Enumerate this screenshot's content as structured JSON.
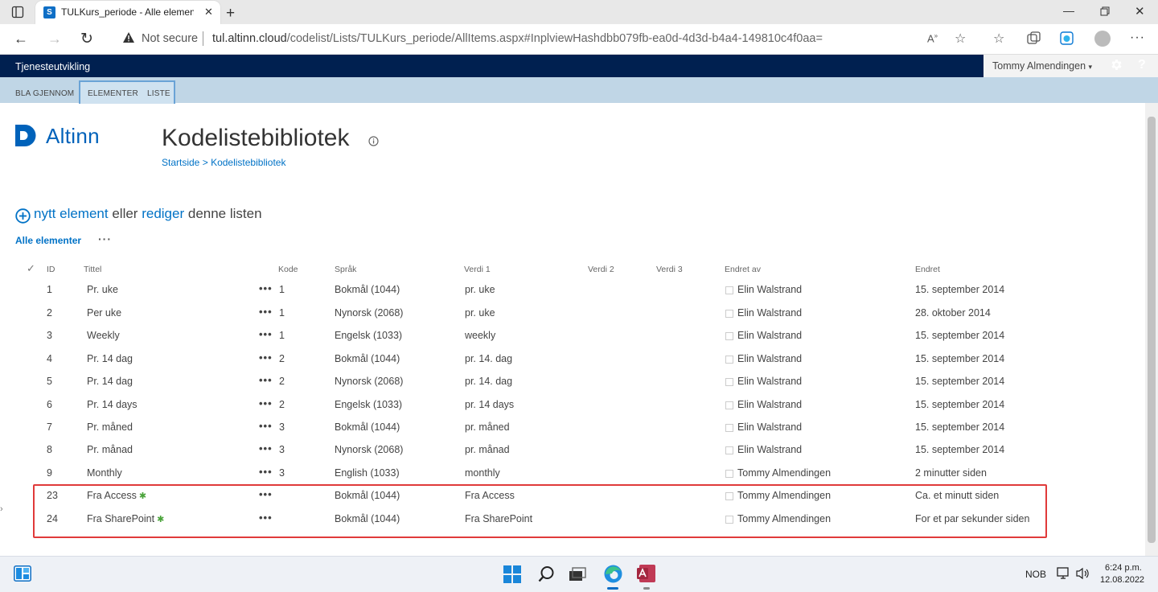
{
  "browser": {
    "tab_title": "TULKurs_periode - Alle elemente",
    "tab_favicon_letter": "S",
    "security_label": "Not secure",
    "url_domain": "tul.altinn.cloud",
    "url_path": "/codelist/Lists/TULKurs_periode/AllItems.aspx#InplviewHashdbb079fb-ea0d-4d3d-b4a4-149810c4f0aa="
  },
  "suitebar": {
    "brand": "Tjenesteutvikling",
    "user": "Tommy Almendingen",
    "settings_icon": "gear-icon",
    "help_label": "?"
  },
  "ribbon": {
    "tabs": [
      "BLA GJENNOM",
      "ELEMENTER",
      "LISTE"
    ]
  },
  "site": {
    "logo_text": "Altinn",
    "title": "Kodelistebibliotek",
    "breadcrumb": [
      "Startside",
      ">",
      "Kodelistebibliotek"
    ]
  },
  "list": {
    "new_item_link": "nytt element",
    "new_item_middle": "eller",
    "edit_link": "rediger",
    "new_item_tail": "denne listen",
    "view_name": "Alle elementer",
    "view_more": "···",
    "columns": {
      "id": "ID",
      "title": "Tittel",
      "kode": "Kode",
      "sprak": "Språk",
      "verdi1": "Verdi 1",
      "verdi2": "Verdi 2",
      "verdi3": "Verdi 3",
      "endret_av": "Endret av",
      "endret": "Endret"
    },
    "rows": [
      {
        "id": "1",
        "title": "Pr. uke",
        "kode": "1",
        "sprak": "Bokmål (1044)",
        "verdi1": "pr. uke",
        "endret_av": "Elin Walstrand",
        "endret": "15. september 2014",
        "new": false
      },
      {
        "id": "2",
        "title": "Per uke",
        "kode": "1",
        "sprak": "Nynorsk (2068)",
        "verdi1": "pr. uke",
        "endret_av": "Elin Walstrand",
        "endret": "28. oktober 2014",
        "new": false
      },
      {
        "id": "3",
        "title": "Weekly",
        "kode": "1",
        "sprak": "Engelsk (1033)",
        "verdi1": "weekly",
        "endret_av": "Elin Walstrand",
        "endret": "15. september 2014",
        "new": false
      },
      {
        "id": "4",
        "title": "Pr. 14 dag",
        "kode": "2",
        "sprak": "Bokmål (1044)",
        "verdi1": "pr. 14. dag",
        "endret_av": "Elin Walstrand",
        "endret": "15. september 2014",
        "new": false
      },
      {
        "id": "5",
        "title": "Pr. 14 dag",
        "kode": "2",
        "sprak": "Nynorsk (2068)",
        "verdi1": "pr. 14. dag",
        "endret_av": "Elin Walstrand",
        "endret": "15. september 2014",
        "new": false
      },
      {
        "id": "6",
        "title": "Pr. 14 days",
        "kode": "2",
        "sprak": "Engelsk (1033)",
        "verdi1": "pr. 14 days",
        "endret_av": "Elin Walstrand",
        "endret": "15. september 2014",
        "new": false
      },
      {
        "id": "7",
        "title": "Pr. måned",
        "kode": "3",
        "sprak": "Bokmål (1044)",
        "verdi1": "pr. måned",
        "endret_av": "Elin Walstrand",
        "endret": "15. september 2014",
        "new": false
      },
      {
        "id": "8",
        "title": "Pr. månad",
        "kode": "3",
        "sprak": "Nynorsk (2068)",
        "verdi1": "pr. månad",
        "endret_av": "Elin Walstrand",
        "endret": "15. september 2014",
        "new": false
      },
      {
        "id": "9",
        "title": "Monthly",
        "kode": "3",
        "sprak": "English (1033)",
        "verdi1": "monthly",
        "endret_av": "Tommy Almendingen",
        "endret": "2 minutter siden",
        "new": false
      },
      {
        "id": "23",
        "title": "Fra Access",
        "kode": "",
        "sprak": "Bokmål (1044)",
        "verdi1": "Fra Access",
        "endret_av": "Tommy Almendingen",
        "endret": "Ca. et minutt siden",
        "new": true
      },
      {
        "id": "24",
        "title": "Fra SharePoint",
        "kode": "",
        "sprak": "Bokmål (1044)",
        "verdi1": "Fra SharePoint",
        "endret_av": "Tommy Almendingen",
        "endret": "For et par sekunder siden",
        "new": true
      }
    ],
    "row_menu": "•••",
    "new_badge": "✱"
  },
  "taskbar": {
    "language": "NOB",
    "time": "6:24 p.m.",
    "date": "12.08.2022"
  },
  "colors": {
    "suitebar": "#002050",
    "ribbon": "#c0d6e6",
    "link": "#0072c6",
    "highlight": "#e03a3a"
  }
}
